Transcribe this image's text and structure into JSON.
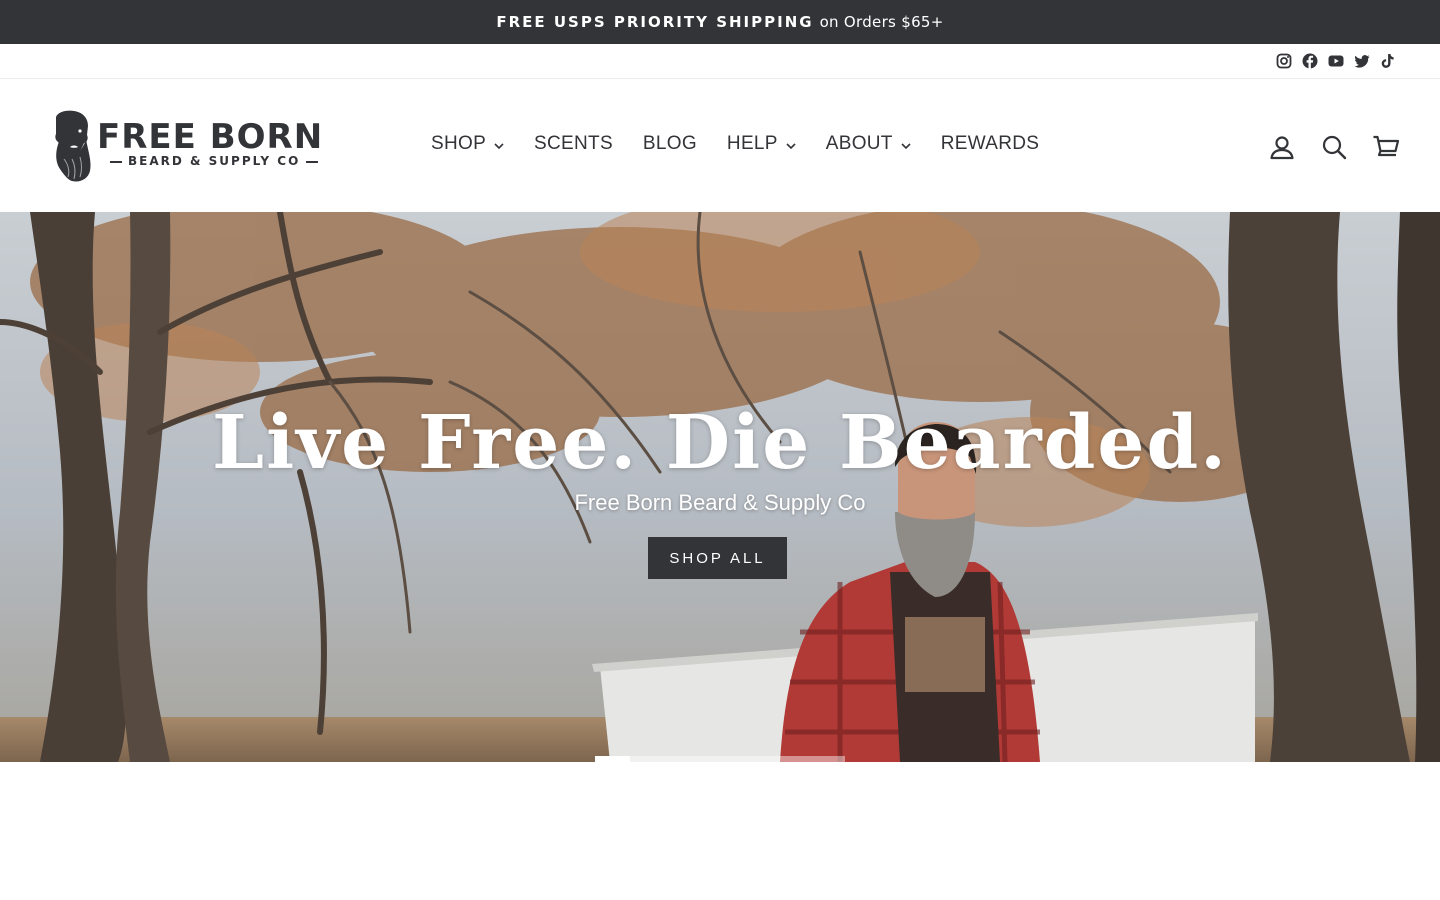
{
  "announcement": {
    "strong_text": "FREE USPS PRIORITY SHIPPING",
    "rest_text": "on Orders $65+"
  },
  "social": {
    "icons": [
      "instagram-icon",
      "facebook-icon",
      "youtube-icon",
      "twitter-icon",
      "tiktok-icon"
    ]
  },
  "logo": {
    "line1": "FREE BORN",
    "line2": "BEARD & SUPPLY CO"
  },
  "nav": {
    "items": [
      {
        "label": "SHOP",
        "has_dropdown": true
      },
      {
        "label": "SCENTS",
        "has_dropdown": false
      },
      {
        "label": "BLOG",
        "has_dropdown": false
      },
      {
        "label": "HELP",
        "has_dropdown": true
      },
      {
        "label": "ABOUT",
        "has_dropdown": true
      },
      {
        "label": "REWARDS",
        "has_dropdown": false
      }
    ]
  },
  "header_icons": [
    "account-icon",
    "search-icon",
    "cart-icon"
  ],
  "hero": {
    "title": "Live Free. Die Bearded.",
    "subtitle": "Free Born Beard & Supply Co",
    "button_label": "SHOP ALL",
    "slide_progress": 0.14
  },
  "colors": {
    "dark": "#333438",
    "white": "#ffffff"
  }
}
